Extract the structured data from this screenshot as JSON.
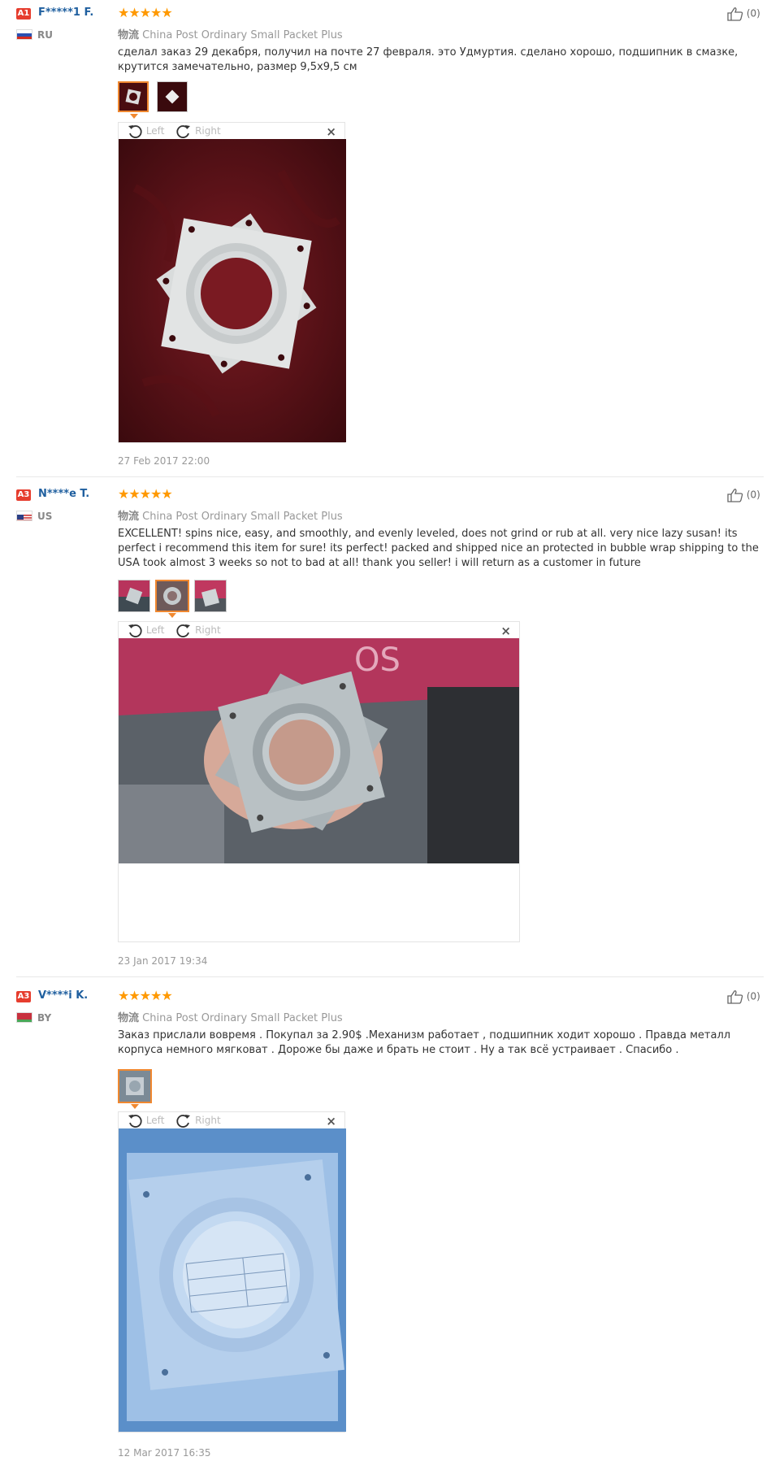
{
  "colors": {
    "star": "#ff9900",
    "badge": "#e63d2e",
    "username": "#1f5f9f",
    "selected": "#f08830"
  },
  "viewer": {
    "left_label": "Left",
    "right_label": "Right",
    "close_label": "×"
  },
  "star_glyphs": "★★★★★",
  "reviews": [
    {
      "badge": "A1",
      "user": "F*****1 F.",
      "country": "RU",
      "stars": 5,
      "logistics_key": "物流",
      "logistics_value": "China Post Ordinary Small Packet Plus",
      "text": "сделал заказ 29 декабря, получил на почте 27 февраля. это Удмуртия. сделано хорошо, подшипник в смазке, крутится замечательно, размер 9,5х9,5 см",
      "date": "27 Feb 2017 22:00",
      "likes": "(0)"
    },
    {
      "badge": "A3",
      "user": "N****e T.",
      "country": "US",
      "stars": 5,
      "logistics_key": "物流",
      "logistics_value": "China Post Ordinary Small Packet Plus",
      "text": "EXCELLENT! spins nice, easy, and smoothly, and evenly leveled, does not grind or rub at all. very nice lazy susan! its perfect i recommend this item for sure! its perfect! packed and shipped nice an protected in bubble wrap shipping to the USA took almost 3 weeks so not to bad at all! thank you seller! i will return as a customer in future",
      "date": "23 Jan 2017 19:34",
      "likes": "(0)"
    },
    {
      "badge": "A3",
      "user": "V****i K.",
      "country": "BY",
      "stars": 5,
      "logistics_key": "物流",
      "logistics_value": "China Post Ordinary Small Packet Plus",
      "text": "Заказ прислали вовремя . Покупал за 2.90$ .Механизм работает , подшипник ходит хорошо . Правда металл корпуса немного мягковат . Дороже бы даже и брать не стоит . Ну а так всё устраивает . Спасибо .",
      "date": "12 Mar 2017 16:35",
      "likes": "(0)"
    }
  ]
}
